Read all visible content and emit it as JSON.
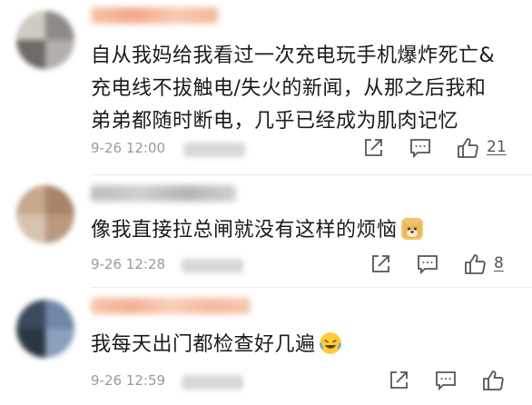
{
  "comments": [
    {
      "text_lines": [
        "自从我妈给我看过一次充电玩手机爆炸死亡&",
        "充电线不拔触电/失火的新闻，从那之后我和",
        "弟弟都随时断电，几乎已经成为肌肉记忆"
      ],
      "time": "9-26 12:00",
      "likes": "21",
      "avatar_icon": "avatar-blurred"
    },
    {
      "text_lines": [
        "像我直接拉总闸就没有这样的烦恼"
      ],
      "emoji": "doge-emoji",
      "time": "9-26 12:28",
      "likes": "8",
      "avatar_icon": "avatar-blurred"
    },
    {
      "text_lines": [
        "我每天出门都检查好几遍"
      ],
      "emoji": "laugh-cry-emoji",
      "time": "9-26 12:59",
      "likes": "",
      "avatar_icon": "avatar-blurred"
    }
  ],
  "icons": {
    "share": "share-icon",
    "comment": "comment-icon",
    "like": "like-icon"
  },
  "colors": {
    "text": "#1a1a1a",
    "meta": "#9a9a9a",
    "icon": "#555555"
  }
}
